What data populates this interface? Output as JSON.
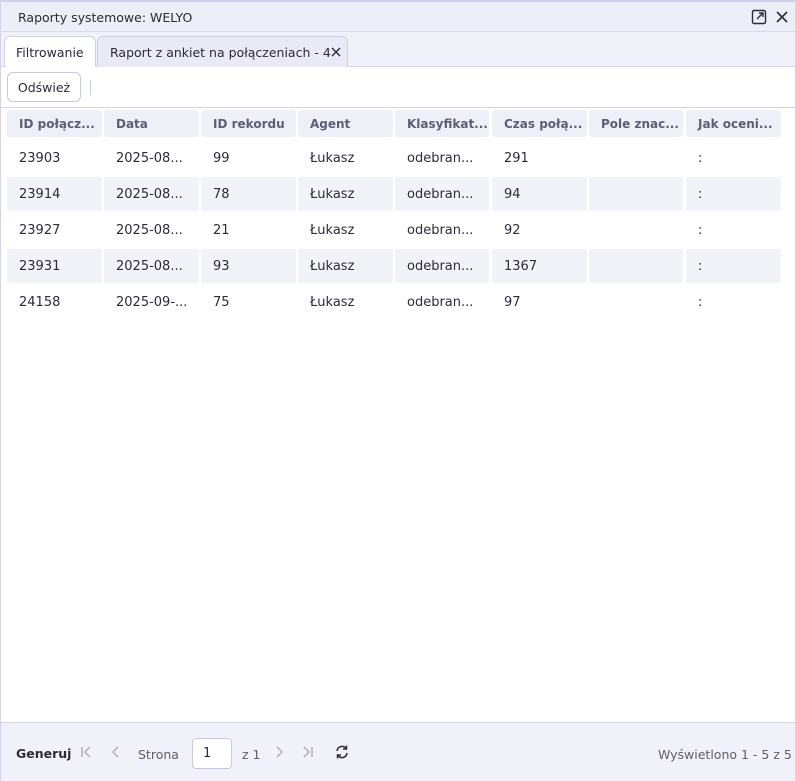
{
  "window": {
    "title": "Raporty systemowe: WELYO"
  },
  "tabs": [
    {
      "label": "Filtrowanie"
    },
    {
      "label": "Raport z ankiet na połączeniach - 4"
    }
  ],
  "toolbar": {
    "refresh_label": "Odśwież"
  },
  "grid": {
    "headers": [
      "ID połącz...",
      "Data",
      "ID rekordu",
      "Agent",
      "Klasyfikat...",
      "Czas połą...",
      "Pole znac...",
      "Jak oceni..."
    ],
    "rows": [
      [
        "23903",
        "2025-08...",
        "99",
        "Łukasz",
        "odebran...",
        "291",
        "",
        ":"
      ],
      [
        "23914",
        "2025-08...",
        "78",
        "Łukasz",
        "odebran...",
        "94",
        "",
        ":"
      ],
      [
        "23927",
        "2025-08...",
        "21",
        "Łukasz",
        "odebran...",
        "92",
        "",
        ":"
      ],
      [
        "23931",
        "2025-08...",
        "93",
        "Łukasz",
        "odebran...",
        "1367",
        "",
        ":"
      ],
      [
        "24158",
        "2025-09-...",
        "75",
        "Łukasz",
        "odebran...",
        "97",
        "",
        ":"
      ]
    ]
  },
  "footer": {
    "generate_label": "Generuj",
    "page_label": "Strona",
    "page_value": "1",
    "of_label": "z 1",
    "summary": "Wyświetlono 1 - 5 z 5"
  },
  "icons": {
    "popout": "popout-icon",
    "close": "close-icon",
    "tab_close": "close-icon",
    "first": "first-page-icon",
    "prev": "prev-page-icon",
    "next": "next-page-icon",
    "last": "last-page-icon",
    "refresh": "refresh-icon"
  }
}
